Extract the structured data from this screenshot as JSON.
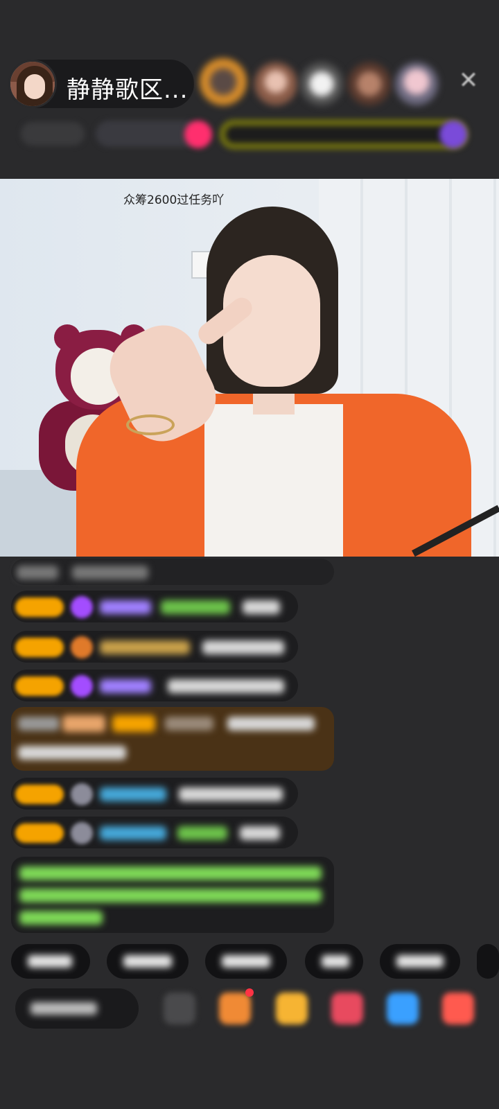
{
  "header": {
    "host_name": "静静歌区...",
    "close_icon": "✕",
    "fan_avatars": [
      "fan-avatar-1",
      "fan-avatar-2",
      "fan-avatar-3",
      "fan-avatar-4",
      "fan-avatar-5"
    ]
  },
  "video": {
    "caption": "众筹2600过任务吖"
  },
  "colors": {
    "background": "#2a2a2c",
    "level_badge": "#f5a300",
    "sweater": "#f0662a",
    "purple_gem": "#a34dff",
    "username_green": "#6cc24a",
    "username_blue": "#45a7d8",
    "system_text_green": "#7ed957"
  },
  "icons": [
    "close-icon",
    "gift-box-icon",
    "treasure-icon",
    "gift-bag-icon",
    "game-icon",
    "more-icon"
  ]
}
